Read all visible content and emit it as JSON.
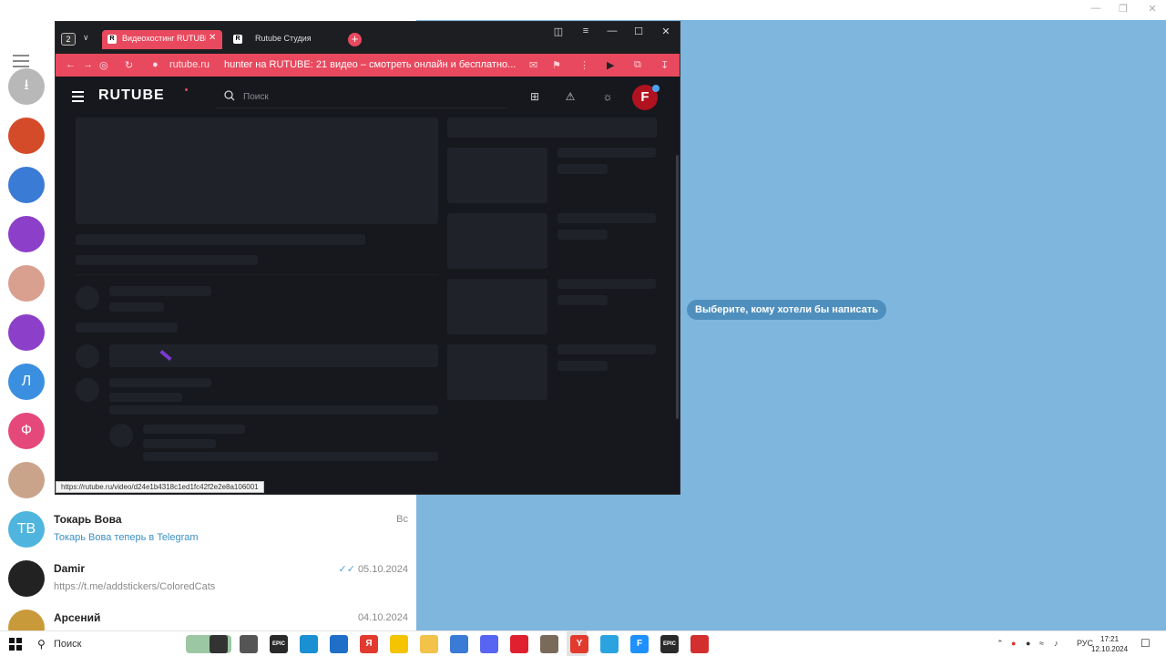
{
  "colors": {
    "telegram_right_bg": "#7fb6dd",
    "browser_accent": "#e8495e",
    "rutube_bg": "#16181d",
    "skeleton": "#1f2228"
  },
  "telegram": {
    "hamburger_icon": "menu-icon",
    "select_chat_hint": "Выберите, кому хотели бы написать",
    "side_avatars": [
      {
        "kind": "archive",
        "icon": "archive-icon",
        "color": "#b8b8b8"
      },
      {
        "kind": "photo",
        "color": "#d44b2a"
      },
      {
        "kind": "photo",
        "color": "#3a7bd5"
      },
      {
        "kind": "photo",
        "color": "#8c3fc8"
      },
      {
        "kind": "photo",
        "color": "#d9a08f"
      },
      {
        "kind": "photo",
        "color": "#8c3fc8"
      },
      {
        "kind": "letter",
        "letter": "Л",
        "color": "#3b8fe0"
      },
      {
        "kind": "letter",
        "letter": "Ф",
        "color": "#e5487a"
      },
      {
        "kind": "photo",
        "color": "#c9a48a"
      }
    ],
    "chats": [
      {
        "initials": "ТВ",
        "avatar_color": "#4fb5de",
        "name": "Токарь Вова",
        "message": "Токарь Вова теперь в Telegram",
        "message_is_link": true,
        "date": "Вс",
        "read": false
      },
      {
        "initials": "",
        "avatar_color": "#222222",
        "name": "Damir",
        "message": "https://t.me/addstickers/ColoredCats",
        "message_is_link": false,
        "date": "05.10.2024",
        "read": true
      },
      {
        "initials": "",
        "avatar_color": "#c99a3a",
        "name": "Арсений",
        "message": "",
        "message_is_link": false,
        "date": "04.10.2024",
        "read": false
      }
    ]
  },
  "browser": {
    "tab_count": "2",
    "tabs": [
      {
        "title": "Видеохостинг RUTUBE",
        "favicon": "R",
        "active": true
      },
      {
        "title": "Rutube Студия",
        "favicon": "R",
        "active": false
      }
    ],
    "host": "rutube.ru",
    "page_title": "hunter на RUTUBE: 21 видео – смотреть онлайн и бесплатно...",
    "status_url": "https://rutube.ru/video/d24e1b4318c1ed1fc42f2e2e8a106001"
  },
  "rutube": {
    "logo": "RUTUBE",
    "search_placeholder": "Поиск",
    "avatar_letter": "F"
  },
  "taskbar": {
    "search_label": "Поиск",
    "apps": [
      {
        "name": "task-view",
        "label": "",
        "color": "#333333"
      },
      {
        "name": "file",
        "label": "",
        "color": "#555555"
      },
      {
        "name": "epic-games",
        "label": "EPIC",
        "color": "#2a2a2a"
      },
      {
        "name": "edge",
        "label": "",
        "color": "#1a8fd1"
      },
      {
        "name": "mail",
        "label": "",
        "color": "#1f6fc9"
      },
      {
        "name": "yandex-browser-red",
        "label": "Я",
        "color": "#e23a2f"
      },
      {
        "name": "beeline",
        "label": "",
        "color": "#f5c400"
      },
      {
        "name": "explorer",
        "label": "",
        "color": "#f2c24b"
      },
      {
        "name": "store",
        "label": "",
        "color": "#3a7bd5"
      },
      {
        "name": "discord",
        "label": "",
        "color": "#5865f2"
      },
      {
        "name": "opera",
        "label": "",
        "color": "#e0202e"
      },
      {
        "name": "game",
        "label": "",
        "color": "#7a6a5a"
      },
      {
        "name": "yandex-browser",
        "label": "Y",
        "color": "#e23a2f"
      },
      {
        "name": "telegram",
        "label": "",
        "color": "#2aa3e0"
      },
      {
        "name": "font-app",
        "label": "F",
        "color": "#1e90ff"
      },
      {
        "name": "epic-launcher",
        "label": "EPIC",
        "color": "#2a2a2a"
      },
      {
        "name": "recorder",
        "label": "",
        "color": "#d32f2f"
      }
    ],
    "language": "РУС",
    "time": "17:21",
    "date": "12.10.2024"
  }
}
